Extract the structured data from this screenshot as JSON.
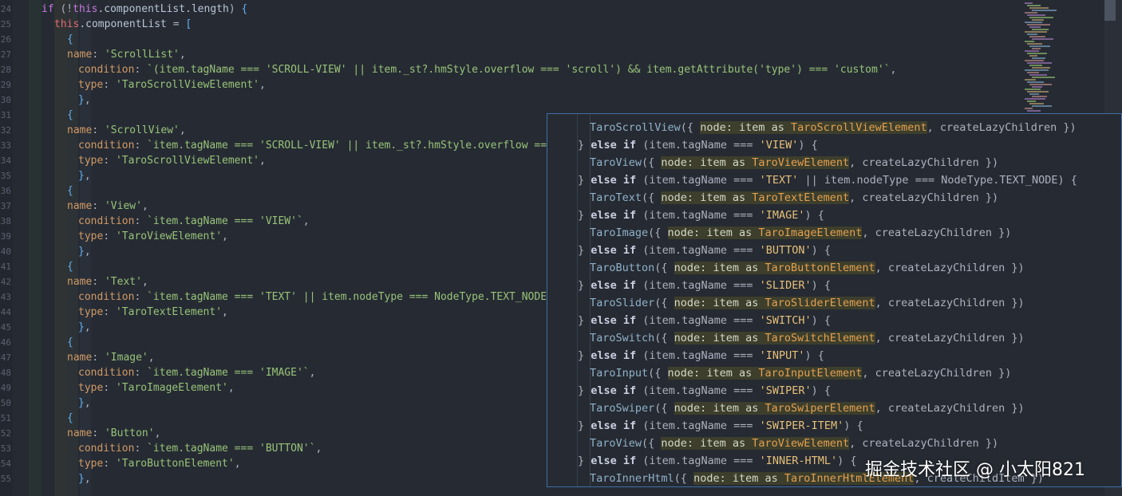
{
  "editor": {
    "lines": [
      {
        "num": "24",
        "tokens": [
          [
            "kw",
            "if "
          ],
          [
            "pun",
            "(!"
          ],
          [
            "kw",
            "this"
          ],
          [
            "prop",
            ".componentList.length"
          ],
          [
            "pun",
            ") "
          ],
          [
            "brk",
            "{"
          ]
        ]
      },
      {
        "num": "25",
        "tokens": [
          [
            "thisc",
            "this"
          ],
          [
            "prop",
            ".componentList "
          ],
          [
            "pun",
            "= "
          ],
          [
            "brk",
            "["
          ]
        ]
      },
      {
        "num": "26",
        "tokens": [
          [
            "brk",
            "{"
          ]
        ]
      },
      {
        "num": "27",
        "tokens": [
          [
            "key",
            "name"
          ],
          [
            "pun",
            ": "
          ],
          [
            "str",
            "'ScrollList'"
          ],
          [
            "pun",
            ","
          ]
        ]
      },
      {
        "num": "28",
        "tokens": [
          [
            "key",
            "condition"
          ],
          [
            "pun",
            ": "
          ],
          [
            "tpl",
            "`(item.tagName === 'SCROLL-VIEW' || item._st?.hmStyle.overflow === 'scroll') && item.getAttribute('type') === 'custom'`"
          ],
          [
            "pun",
            ","
          ]
        ]
      },
      {
        "num": "29",
        "tokens": [
          [
            "key",
            "type"
          ],
          [
            "pun",
            ": "
          ],
          [
            "str",
            "'TaroScrollViewElement'"
          ],
          [
            "pun",
            ","
          ]
        ]
      },
      {
        "num": "30",
        "tokens": [
          [
            "brk",
            "}"
          ],
          [
            "pun",
            ","
          ]
        ]
      },
      {
        "num": "31",
        "tokens": [
          [
            "brk",
            "{"
          ]
        ]
      },
      {
        "num": "32",
        "tokens": [
          [
            "key",
            "name"
          ],
          [
            "pun",
            ": "
          ],
          [
            "str",
            "'ScrollView'"
          ],
          [
            "pun",
            ","
          ]
        ]
      },
      {
        "num": "33",
        "tokens": [
          [
            "key",
            "condition"
          ],
          [
            "pun",
            ": "
          ],
          [
            "tpl",
            "`item.tagName === 'SCROLL-VIEW' || item._st?.hmStyle.overflow ==="
          ]
        ]
      },
      {
        "num": "34",
        "tokens": [
          [
            "key",
            "type"
          ],
          [
            "pun",
            ": "
          ],
          [
            "str",
            "'TaroScrollViewElement'"
          ],
          [
            "pun",
            ","
          ]
        ]
      },
      {
        "num": "35",
        "tokens": [
          [
            "brk",
            "}"
          ],
          [
            "pun",
            ","
          ]
        ]
      },
      {
        "num": "36",
        "tokens": [
          [
            "brk",
            "{"
          ]
        ]
      },
      {
        "num": "37",
        "tokens": [
          [
            "key",
            "name"
          ],
          [
            "pun",
            ": "
          ],
          [
            "str",
            "'View'"
          ],
          [
            "pun",
            ","
          ]
        ]
      },
      {
        "num": "38",
        "tokens": [
          [
            "key",
            "condition"
          ],
          [
            "pun",
            ": "
          ],
          [
            "tpl",
            "`item.tagName === 'VIEW'`"
          ],
          [
            "pun",
            ","
          ]
        ]
      },
      {
        "num": "39",
        "tokens": [
          [
            "key",
            "type"
          ],
          [
            "pun",
            ": "
          ],
          [
            "str",
            "'TaroViewElement'"
          ],
          [
            "pun",
            ","
          ]
        ]
      },
      {
        "num": "40",
        "tokens": [
          [
            "brk",
            "}"
          ],
          [
            "pun",
            ","
          ]
        ]
      },
      {
        "num": "41",
        "tokens": [
          [
            "brk",
            "{"
          ]
        ]
      },
      {
        "num": "42",
        "tokens": [
          [
            "key",
            "name"
          ],
          [
            "pun",
            ": "
          ],
          [
            "str",
            "'Text'"
          ],
          [
            "pun",
            ","
          ]
        ]
      },
      {
        "num": "43",
        "tokens": [
          [
            "key",
            "condition"
          ],
          [
            "pun",
            ": "
          ],
          [
            "tpl",
            "`item.tagName === 'TEXT' || item.nodeType === NodeType.TEXT_NODE"
          ]
        ]
      },
      {
        "num": "44",
        "tokens": [
          [
            "key",
            "type"
          ],
          [
            "pun",
            ": "
          ],
          [
            "str",
            "'TaroTextElement'"
          ],
          [
            "pun",
            ","
          ]
        ]
      },
      {
        "num": "45",
        "tokens": [
          [
            "brk",
            "}"
          ],
          [
            "pun",
            ","
          ]
        ]
      },
      {
        "num": "46",
        "tokens": [
          [
            "brk",
            "{"
          ]
        ]
      },
      {
        "num": "47",
        "tokens": [
          [
            "key",
            "name"
          ],
          [
            "pun",
            ": "
          ],
          [
            "str",
            "'Image'"
          ],
          [
            "pun",
            ","
          ]
        ]
      },
      {
        "num": "48",
        "tokens": [
          [
            "key",
            "condition"
          ],
          [
            "pun",
            ": "
          ],
          [
            "tpl",
            "`item.tagName === 'IMAGE'`"
          ],
          [
            "pun",
            ","
          ]
        ]
      },
      {
        "num": "49",
        "tokens": [
          [
            "key",
            "type"
          ],
          [
            "pun",
            ": "
          ],
          [
            "str",
            "'TaroImageElement'"
          ],
          [
            "pun",
            ","
          ]
        ]
      },
      {
        "num": "50",
        "tokens": [
          [
            "brk",
            "}"
          ],
          [
            "pun",
            ","
          ]
        ]
      },
      {
        "num": "51",
        "tokens": [
          [
            "brk",
            "{"
          ]
        ]
      },
      {
        "num": "52",
        "tokens": [
          [
            "key",
            "name"
          ],
          [
            "pun",
            ": "
          ],
          [
            "str",
            "'Button'"
          ],
          [
            "pun",
            ","
          ]
        ]
      },
      {
        "num": "53",
        "tokens": [
          [
            "key",
            "condition"
          ],
          [
            "pun",
            ": "
          ],
          [
            "tpl",
            "`item.tagName === 'BUTTON'`"
          ],
          [
            "pun",
            ","
          ]
        ]
      },
      {
        "num": "54",
        "tokens": [
          [
            "key",
            "type"
          ],
          [
            "pun",
            ": "
          ],
          [
            "str",
            "'TaroButtonElement'"
          ],
          [
            "pun",
            ","
          ]
        ]
      },
      {
        "num": "55",
        "tokens": [
          [
            "brk",
            "}"
          ],
          [
            "pun",
            ","
          ]
        ]
      }
    ]
  },
  "popup": {
    "lines": [
      {
        "tokens": [
          [
            "p-comp",
            "TaroScrollView"
          ],
          [
            "pun",
            "({ "
          ],
          [
            "p-hl",
            "node: item as "
          ],
          [
            "p-type",
            "TaroScrollViewElement"
          ],
          [
            "pun",
            ", createLazyChildren })"
          ]
        ]
      },
      {
        "tokens": [
          [
            "pun",
            "} "
          ],
          [
            "p-kw",
            "else if "
          ],
          [
            "pun",
            "(item.tagName === "
          ],
          [
            "p-str",
            "'VIEW'"
          ],
          [
            "pun",
            ") {"
          ]
        ]
      },
      {
        "tokens": [
          [
            "p-comp",
            "TaroView"
          ],
          [
            "pun",
            "({ "
          ],
          [
            "p-hl",
            "node: item as "
          ],
          [
            "p-type",
            "TaroViewElement"
          ],
          [
            "pun",
            ", createLazyChildren })"
          ]
        ]
      },
      {
        "tokens": [
          [
            "pun",
            "} "
          ],
          [
            "p-kw",
            "else if "
          ],
          [
            "pun",
            "(item.tagName === "
          ],
          [
            "p-str",
            "'TEXT'"
          ],
          [
            "pun",
            " || item.nodeType === NodeType.TEXT_NODE) {"
          ]
        ]
      },
      {
        "tokens": [
          [
            "p-comp",
            "TaroText"
          ],
          [
            "pun",
            "({ "
          ],
          [
            "p-hl",
            "node: item as "
          ],
          [
            "p-type",
            "TaroTextElement"
          ],
          [
            "pun",
            ", createLazyChildren })"
          ]
        ]
      },
      {
        "tokens": [
          [
            "pun",
            "} "
          ],
          [
            "p-kw",
            "else if "
          ],
          [
            "pun",
            "(item.tagName === "
          ],
          [
            "p-str",
            "'IMAGE'"
          ],
          [
            "pun",
            ") {"
          ]
        ]
      },
      {
        "tokens": [
          [
            "p-comp",
            "TaroImage"
          ],
          [
            "pun",
            "({ "
          ],
          [
            "p-hl",
            "node: item as "
          ],
          [
            "p-type",
            "TaroImageElement"
          ],
          [
            "pun",
            ", createLazyChildren })"
          ]
        ]
      },
      {
        "tokens": [
          [
            "pun",
            "} "
          ],
          [
            "p-kw",
            "else if "
          ],
          [
            "pun",
            "(item.tagName === "
          ],
          [
            "p-str",
            "'BUTTON'"
          ],
          [
            "pun",
            ") {"
          ]
        ]
      },
      {
        "tokens": [
          [
            "p-comp",
            "TaroButton"
          ],
          [
            "pun",
            "({ "
          ],
          [
            "p-hl",
            "node: item as "
          ],
          [
            "p-type",
            "TaroButtonElement"
          ],
          [
            "pun",
            ", createLazyChildren })"
          ]
        ]
      },
      {
        "tokens": [
          [
            "pun",
            "} "
          ],
          [
            "p-kw",
            "else if "
          ],
          [
            "pun",
            "(item.tagName === "
          ],
          [
            "p-str",
            "'SLIDER'"
          ],
          [
            "pun",
            ") {"
          ]
        ]
      },
      {
        "tokens": [
          [
            "p-comp",
            "TaroSlider"
          ],
          [
            "pun",
            "({ "
          ],
          [
            "p-hl",
            "node: item as "
          ],
          [
            "p-type",
            "TaroSliderElement"
          ],
          [
            "pun",
            ", createLazyChildren })"
          ]
        ]
      },
      {
        "tokens": [
          [
            "pun",
            "} "
          ],
          [
            "p-kw",
            "else if "
          ],
          [
            "pun",
            "(item.tagName === "
          ],
          [
            "p-str",
            "'SWITCH'"
          ],
          [
            "pun",
            ") {"
          ]
        ]
      },
      {
        "tokens": [
          [
            "p-comp",
            "TaroSwitch"
          ],
          [
            "pun",
            "({ "
          ],
          [
            "p-hl",
            "node: item as "
          ],
          [
            "p-type",
            "TaroSwitchElement"
          ],
          [
            "pun",
            ", createLazyChildren })"
          ]
        ]
      },
      {
        "tokens": [
          [
            "pun",
            "} "
          ],
          [
            "p-kw",
            "else if "
          ],
          [
            "pun",
            "(item.tagName === "
          ],
          [
            "p-str",
            "'INPUT'"
          ],
          [
            "pun",
            ") {"
          ]
        ]
      },
      {
        "tokens": [
          [
            "p-comp",
            "TaroInput"
          ],
          [
            "pun",
            "({ "
          ],
          [
            "p-hl",
            "node: item as "
          ],
          [
            "p-type",
            "TaroInputElement"
          ],
          [
            "pun",
            ", createLazyChildren })"
          ]
        ]
      },
      {
        "tokens": [
          [
            "pun",
            "} "
          ],
          [
            "p-kw",
            "else if "
          ],
          [
            "pun",
            "(item.tagName === "
          ],
          [
            "p-str",
            "'SWIPER'"
          ],
          [
            "pun",
            ") {"
          ]
        ]
      },
      {
        "tokens": [
          [
            "p-comp",
            "TaroSwiper"
          ],
          [
            "pun",
            "({ "
          ],
          [
            "p-hl",
            "node: item as "
          ],
          [
            "p-type",
            "TaroSwiperElement"
          ],
          [
            "pun",
            ", createLazyChildren })"
          ]
        ]
      },
      {
        "tokens": [
          [
            "pun",
            "} "
          ],
          [
            "p-kw",
            "else if "
          ],
          [
            "pun",
            "(item.tagName === "
          ],
          [
            "p-str",
            "'SWIPER-ITEM'"
          ],
          [
            "pun",
            ") {"
          ]
        ]
      },
      {
        "tokens": [
          [
            "p-comp",
            "TaroView"
          ],
          [
            "pun",
            "({ "
          ],
          [
            "p-hl",
            "node: item as "
          ],
          [
            "p-type",
            "TaroViewElement"
          ],
          [
            "pun",
            ", createLazyChildren })"
          ]
        ]
      },
      {
        "tokens": [
          [
            "pun",
            "} "
          ],
          [
            "p-kw",
            "else if "
          ],
          [
            "pun",
            "(item.tagName === "
          ],
          [
            "p-str",
            "'INNER-HTML'"
          ],
          [
            "pun",
            ") {"
          ]
        ]
      },
      {
        "tokens": [
          [
            "p-comp",
            "TaroInnerHtml"
          ],
          [
            "pun",
            "({ "
          ],
          [
            "p-hl",
            "node: item as "
          ],
          [
            "p-type",
            "TaroInnerHtmlElement"
          ],
          [
            "pun",
            ", createChildItem })"
          ]
        ]
      }
    ]
  },
  "watermark": "掘金技术社区 @ 小太阳821",
  "colors": {
    "editor_bg": "#262b33",
    "popup_border": "#3e6ea8",
    "highlight_bg": "#3d3f2c"
  }
}
